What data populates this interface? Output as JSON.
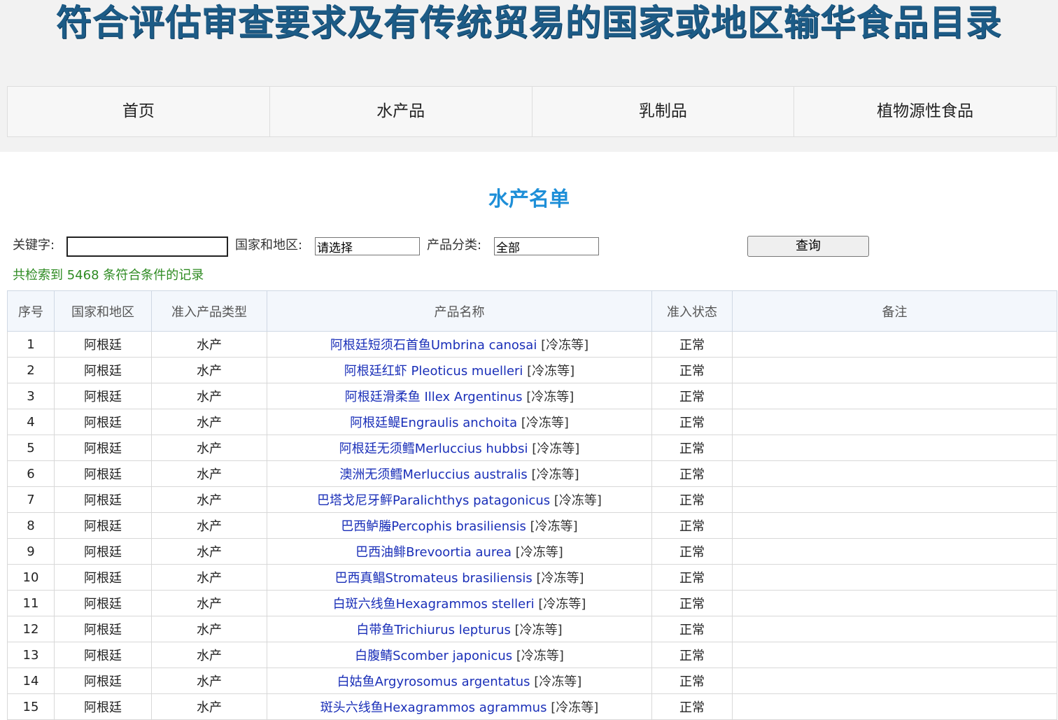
{
  "banner": {
    "title": "符合评估审查要求及有传统贸易的国家或地区输华食品目录"
  },
  "nav": {
    "items": [
      {
        "label": "首页"
      },
      {
        "label": "水产品"
      },
      {
        "label": "乳制品"
      },
      {
        "label": "植物源性食品"
      }
    ]
  },
  "list_title": "水产名单",
  "search": {
    "keyword_label": "关键字:",
    "keyword_value": "",
    "region_label": "国家和地区:",
    "region_value": "请选择",
    "category_label": "产品分类:",
    "category_value": "全部",
    "query_button": "查询"
  },
  "result_count": "共检索到 5468 条符合条件的记录",
  "table": {
    "headers": [
      "序号",
      "国家和地区",
      "准入产品类型",
      "产品名称",
      "准入状态",
      "备注"
    ],
    "rows": [
      {
        "no": "1",
        "region": "阿根廷",
        "type": "水产",
        "name": "阿根廷短须石首鱼Umbrina canosai",
        "tag": "[冷冻等]",
        "status": "正常",
        "note": ""
      },
      {
        "no": "2",
        "region": "阿根廷",
        "type": "水产",
        "name": "阿根廷红虾 Pleoticus muelleri",
        "tag": "[冷冻等]",
        "status": "正常",
        "note": ""
      },
      {
        "no": "3",
        "region": "阿根廷",
        "type": "水产",
        "name": "阿根廷滑柔鱼 Illex Argentinus",
        "tag": "[冷冻等]",
        "status": "正常",
        "note": ""
      },
      {
        "no": "4",
        "region": "阿根廷",
        "type": "水产",
        "name": "阿根廷鳀Engraulis anchoita",
        "tag": "[冷冻等]",
        "status": "正常",
        "note": ""
      },
      {
        "no": "5",
        "region": "阿根廷",
        "type": "水产",
        "name": "阿根廷无须鳕Merluccius hubbsi",
        "tag": "[冷冻等]",
        "status": "正常",
        "note": ""
      },
      {
        "no": "6",
        "region": "阿根廷",
        "type": "水产",
        "name": "澳洲无须鳕Merluccius australis",
        "tag": "[冷冻等]",
        "status": "正常",
        "note": ""
      },
      {
        "no": "7",
        "region": "阿根廷",
        "type": "水产",
        "name": "巴塔戈尼牙鲆Paralichthys patagonicus",
        "tag": "[冷冻等]",
        "status": "正常",
        "note": ""
      },
      {
        "no": "8",
        "region": "阿根廷",
        "type": "水产",
        "name": "巴西鲈螣Percophis brasiliensis",
        "tag": "[冷冻等]",
        "status": "正常",
        "note": ""
      },
      {
        "no": "9",
        "region": "阿根廷",
        "type": "水产",
        "name": "巴西油鲱Brevoortia aurea",
        "tag": "[冷冻等]",
        "status": "正常",
        "note": ""
      },
      {
        "no": "10",
        "region": "阿根廷",
        "type": "水产",
        "name": "巴西真鲳Stromateus brasiliensis",
        "tag": "[冷冻等]",
        "status": "正常",
        "note": ""
      },
      {
        "no": "11",
        "region": "阿根廷",
        "type": "水产",
        "name": "白斑六线鱼Hexagrammos stelleri",
        "tag": "[冷冻等]",
        "status": "正常",
        "note": ""
      },
      {
        "no": "12",
        "region": "阿根廷",
        "type": "水产",
        "name": "白带鱼Trichiurus lepturus",
        "tag": "[冷冻等]",
        "status": "正常",
        "note": ""
      },
      {
        "no": "13",
        "region": "阿根廷",
        "type": "水产",
        "name": "白腹鲭Scomber japonicus",
        "tag": "[冷冻等]",
        "status": "正常",
        "note": ""
      },
      {
        "no": "14",
        "region": "阿根廷",
        "type": "水产",
        "name": "白姑鱼Argyrosomus argentatus",
        "tag": "[冷冻等]",
        "status": "正常",
        "note": ""
      },
      {
        "no": "15",
        "region": "阿根廷",
        "type": "水产",
        "name": "斑头六线鱼Hexagrammos agrammus",
        "tag": "[冷冻等]",
        "status": "正常",
        "note": ""
      }
    ]
  }
}
